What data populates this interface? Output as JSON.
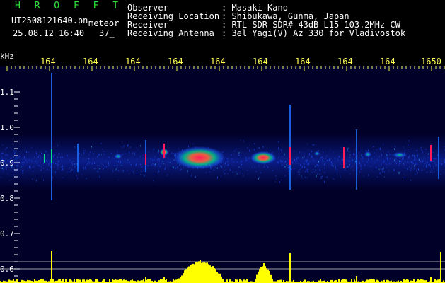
{
  "header": {
    "brand": "H R O F F T",
    "filename": "UT2508121640.pn",
    "mode": "meteor",
    "datetime": "25.08.12 16:40",
    "counter": "37_",
    "labels": [
      "Observer",
      "Receiving Location",
      "Receiver",
      "Receiving Antenna"
    ],
    "values": [
      ": Masaki Kano",
      ": Shibukawa, Gunma, Japan",
      ": RTL-SDR SDR# 43dB L15 103.2MHz CW",
      ": 3el Yagi(V) Az 330 for Vladivostok"
    ]
  },
  "time_axis": {
    "labels": [
      "164",
      "164",
      "164",
      "164",
      "164",
      "164",
      "164",
      "164",
      "164",
      "1650"
    ]
  },
  "freq_axis": {
    "unit": "kHz",
    "ticks": [
      "1.1",
      "1.0",
      "0.9",
      "0.8",
      "0.7",
      "0.6"
    ]
  },
  "colors": {
    "background": "#000028",
    "header_green": "#32e03a",
    "axis_yellow": "#ffff55",
    "histogram": "#ffff00",
    "signal_hot": "#ff1a5a",
    "signal_warm": "#00e08a",
    "signal_cool": "#1e60ff"
  }
}
